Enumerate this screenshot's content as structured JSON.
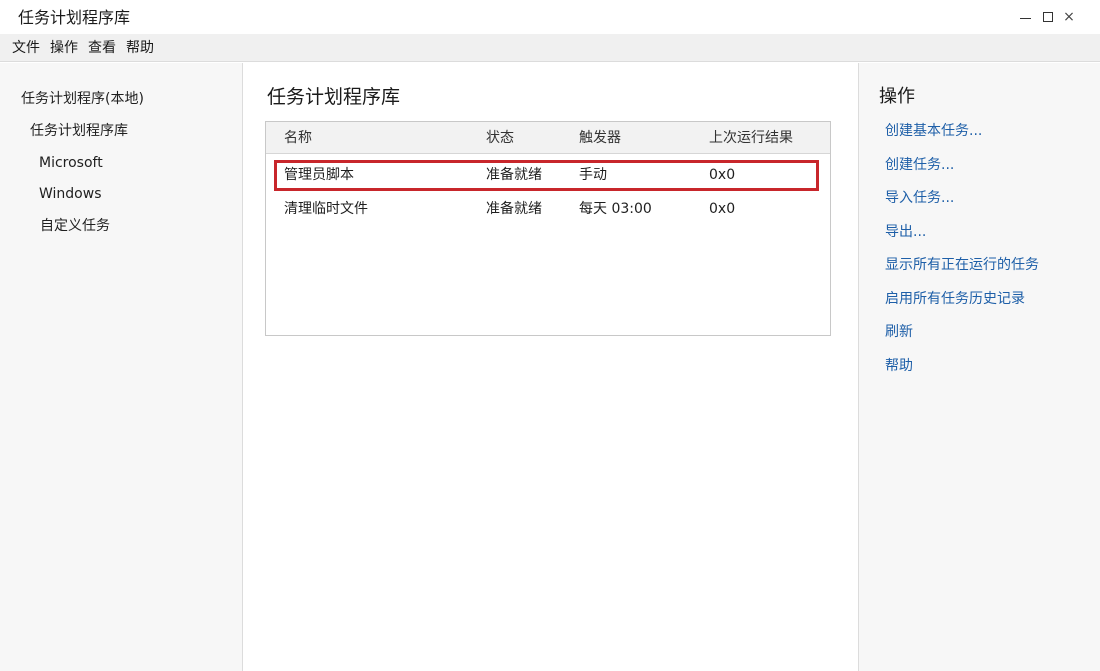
{
  "window": {
    "title": "任务计划程序库",
    "min_glyph": "—",
    "close_glyph": "×"
  },
  "menu": [
    "文件",
    "操作",
    "查看",
    "帮助"
  ],
  "tree": [
    {
      "label": "任务计划程序(本地)",
      "level": 0
    },
    {
      "label": "任务计划程序库",
      "level": 1
    },
    {
      "label": "Microsoft",
      "level": 2
    },
    {
      "label": "Windows",
      "level": 2
    },
    {
      "label": "自定义任务",
      "level": 2
    }
  ],
  "center": {
    "title": "任务计划程序库",
    "columns": [
      "名称",
      "状态",
      "触发器",
      "上次运行结果"
    ],
    "rows": [
      [
        "管理员脚本",
        "准备就绪",
        "手动",
        "0x0"
      ],
      [
        "清理临时文件",
        "准备就绪",
        "每天 03:00",
        "0x0"
      ]
    ],
    "highlight_color": "#c8262b"
  },
  "actions": {
    "title": "操作",
    "items": [
      "创建基本任务...",
      "创建任务...",
      "导入任务...",
      "导出...",
      "显示所有正在运行的任务",
      "启用所有任务历史记录",
      "刷新",
      "帮助"
    ],
    "link_color": "#1e5fa8"
  }
}
